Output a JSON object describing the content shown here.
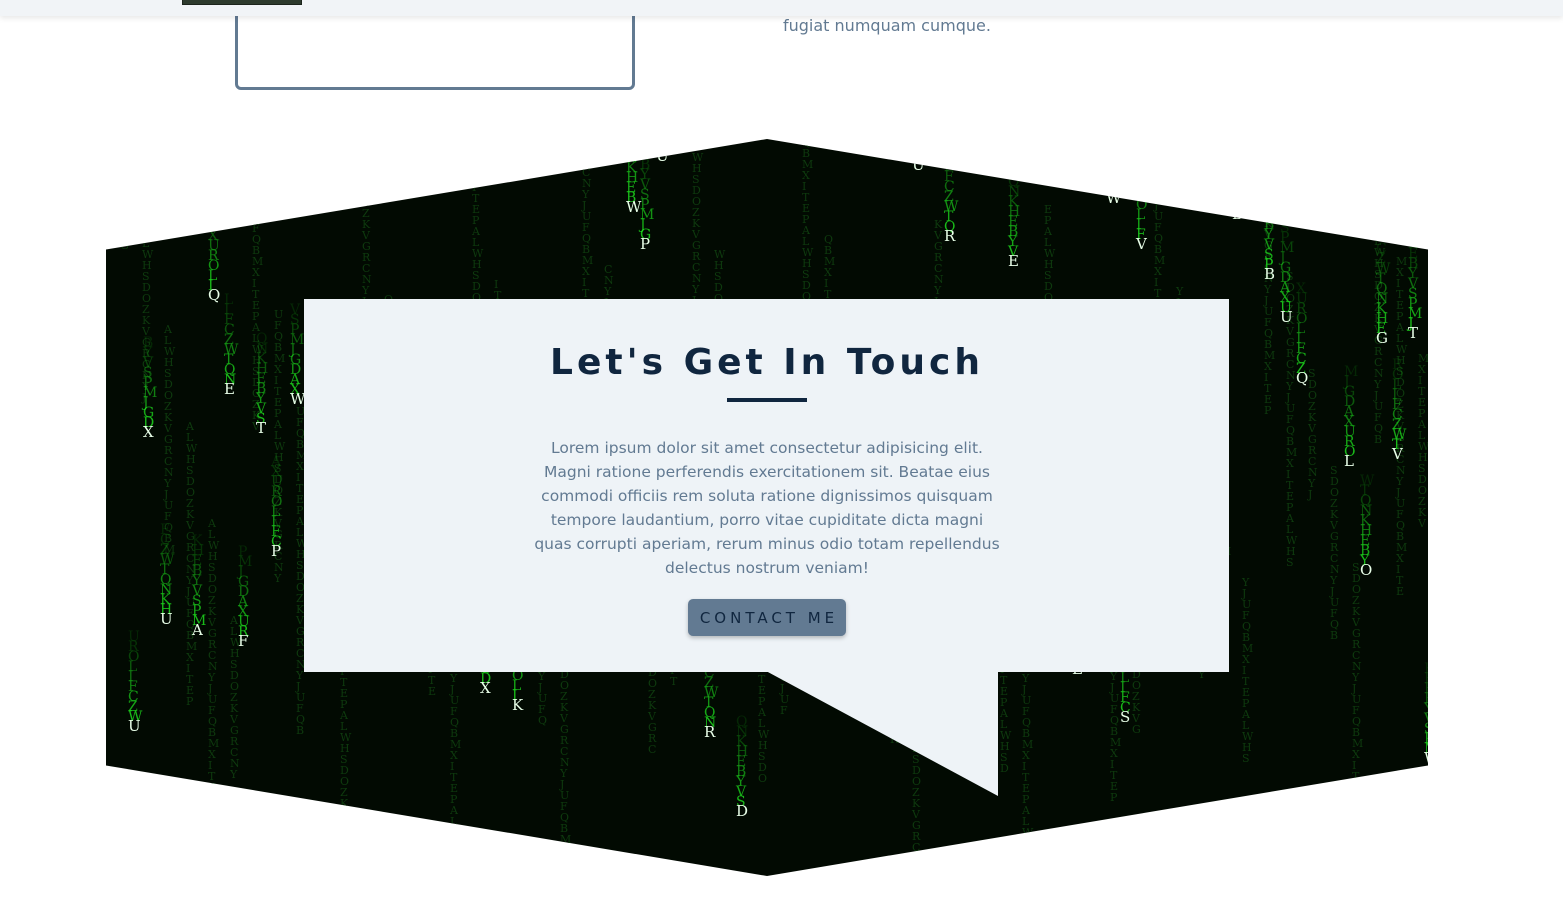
{
  "previous_section": {
    "text_tail": "fugiat numquam cumque."
  },
  "contact": {
    "title": "Let's Get In Touch",
    "body": "Lorem ipsum dolor sit amet consectetur adipisicing elit. Magni ratione perferendis exercitationem sit. Beatae eius commodi officiis rem soluta ratione dignissimos quisquam tempore laudantium, porro vitae cupiditate dicta magni quas corrupti aperiam, rerum minus odio totam repellendus delectus nostrum veniam!",
    "button_label": "CONTACT ME"
  },
  "matrix": {
    "background_color": "#020a02",
    "glyph_color": "#22ff22",
    "head_color": "#e8ffe8",
    "columns": [
      {
        "letter": "X"
      },
      {
        "letter": "Q"
      },
      {
        "letter": "E"
      },
      {
        "letter": "T"
      },
      {
        "letter": "W"
      },
      {
        "letter": "P"
      },
      {
        "letter": "U"
      },
      {
        "letter": "A"
      },
      {
        "letter": "F"
      },
      {
        "letter": "U"
      },
      {
        "letter": "W"
      },
      {
        "letter": "P"
      },
      {
        "letter": "U"
      },
      {
        "letter": "R"
      },
      {
        "letter": "E"
      },
      {
        "letter": "W"
      },
      {
        "letter": "V"
      },
      {
        "letter": "B"
      },
      {
        "letter": "B"
      },
      {
        "letter": "U"
      },
      {
        "letter": "Q"
      },
      {
        "letter": "G"
      },
      {
        "letter": "T"
      },
      {
        "letter": "L"
      },
      {
        "letter": "V"
      },
      {
        "letter": "O"
      },
      {
        "letter": "X"
      },
      {
        "letter": "K"
      },
      {
        "letter": "R"
      },
      {
        "letter": "D"
      },
      {
        "letter": "E"
      },
      {
        "letter": "S"
      },
      {
        "letter": "U"
      },
      {
        "letter": "W"
      }
    ]
  }
}
